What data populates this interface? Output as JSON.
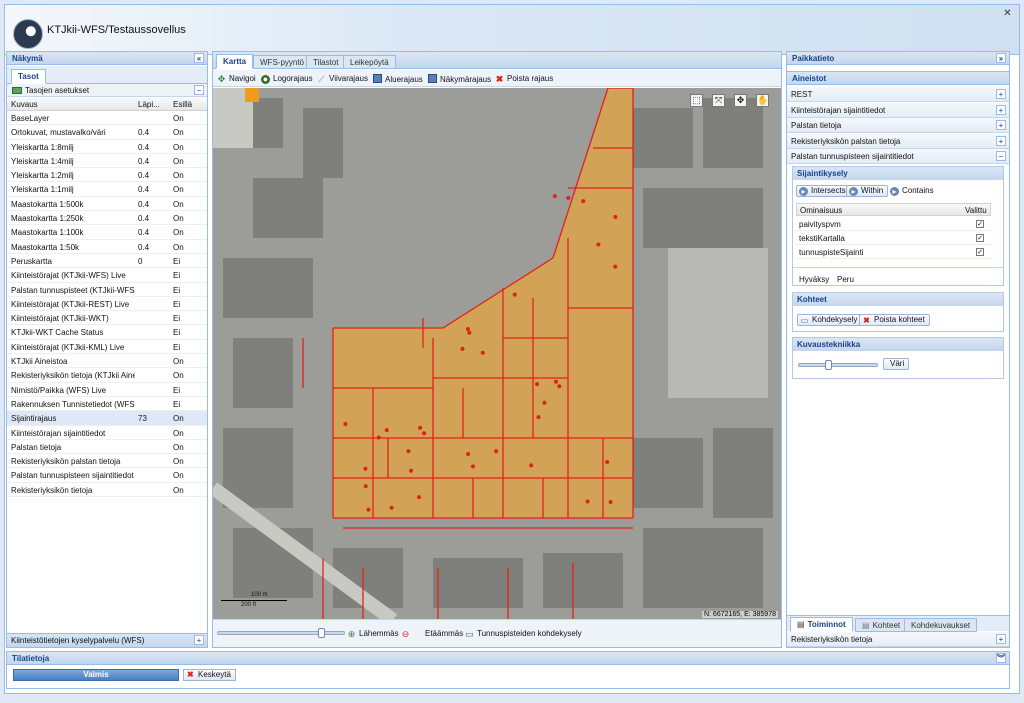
{
  "app": {
    "title": "KTJkii-WFS/Testaussovellus",
    "close_glyph": "✕"
  },
  "left": {
    "title": "Näkymä",
    "collapse_glyph": "«",
    "tab": "Tasot",
    "layer_settings": "Tasojen asetukset",
    "columns": {
      "name": "Kuvaus",
      "opacity": "Läpi...",
      "visible": "Esillä"
    },
    "rows": [
      {
        "name": "BaseLayer",
        "opacity": "",
        "visible": "On"
      },
      {
        "name": "Ortokuvat, mustavalko/väri",
        "opacity": "0.4",
        "visible": "On"
      },
      {
        "name": "Yleiskartta 1:8milj",
        "opacity": "0.4",
        "visible": "On"
      },
      {
        "name": "Yleiskartta 1:4milj",
        "opacity": "0.4",
        "visible": "On"
      },
      {
        "name": "Yleiskartta 1:2milj",
        "opacity": "0.4",
        "visible": "On"
      },
      {
        "name": "Yleiskartta 1:1milj",
        "opacity": "0.4",
        "visible": "On"
      },
      {
        "name": "Maastokartta 1:500k",
        "opacity": "0.4",
        "visible": "On"
      },
      {
        "name": "Maastokartta 1:250k",
        "opacity": "0.4",
        "visible": "On"
      },
      {
        "name": "Maastokartta 1:100k",
        "opacity": "0.4",
        "visible": "On"
      },
      {
        "name": "Maastokartta 1:50k",
        "opacity": "0.4",
        "visible": "On"
      },
      {
        "name": "Peruskartta",
        "opacity": "0",
        "visible": "Ei"
      },
      {
        "name": "Kiinteistörajat (KTJkii-WFS) Live",
        "opacity": "",
        "visible": "Ei"
      },
      {
        "name": "Palstan tunnuspisteet (KTJkii-WFS) ...",
        "opacity": "",
        "visible": "Ei"
      },
      {
        "name": "Kiinteistörajat (KTJkii-REST) Live",
        "opacity": "",
        "visible": "Ei"
      },
      {
        "name": "Kiinteistörajat (KTJkii-WKT)",
        "opacity": "",
        "visible": "Ei"
      },
      {
        "name": "KTJkii-WKT Cache Status",
        "opacity": "",
        "visible": "Ei"
      },
      {
        "name": "Kiinteistörajat (KTJkii-KML) Live",
        "opacity": "",
        "visible": "Ei"
      },
      {
        "name": "KTJkii Aineistoa",
        "opacity": "",
        "visible": "On"
      },
      {
        "name": "Rekisteriyksikön tietoja (KTJkii Ainei...",
        "opacity": "",
        "visible": "On"
      },
      {
        "name": "Nimistö/Paikka (WFS) Live",
        "opacity": "",
        "visible": "Ei"
      },
      {
        "name": "Rakennuksen Tunnistetiedot (WFS) ...",
        "opacity": "",
        "visible": "Ei"
      },
      {
        "name": "Sijaintirajaus",
        "opacity": "73",
        "visible": "On"
      },
      {
        "name": "Kiinteistörajan sijaintitiedot",
        "opacity": "",
        "visible": "On"
      },
      {
        "name": "Palstan tietoja",
        "opacity": "",
        "visible": "On"
      },
      {
        "name": "Rekisteriyksikön palstan tietoja",
        "opacity": "",
        "visible": "On"
      },
      {
        "name": "Palstan tunnuspisteen sijaintitiedot",
        "opacity": "",
        "visible": "On"
      },
      {
        "name": "Rekisteriyksikön tietoja",
        "opacity": "",
        "visible": "On"
      }
    ],
    "footer": "Kiinteistötietojen kyselypalvelu (WFS)"
  },
  "center": {
    "tabs": [
      "Kartta",
      "WFS-pyyntö",
      "Tilastot",
      "Leikepöytä"
    ],
    "tools": [
      "Navigoi",
      "Logorajaus",
      "Viivarajaus",
      "Aluerajaus",
      "Näkymärajaus",
      "Poista rajaus"
    ],
    "coords": "N: 6672165, E: 385978",
    "scale": {
      "m": "100 m",
      "ft": "200 ft"
    },
    "zoom_in": "Lähemmäs",
    "zoom_out": "Etäämmäs",
    "point_query": "Tunnuspisteiden kohdekysely",
    "zoom_level": 0.82
  },
  "right": {
    "title": "Paikkatieto",
    "expand_glyph": "»",
    "datasets_title": "Aineistot",
    "datasets": [
      "REST",
      "Kiinteistörajan sijaintitiedot",
      "Palstan tietoja",
      "Rekisteriyksikön palstan tietoja",
      "Palstan tunnuspisteen sijaintitiedot"
    ],
    "location_query": {
      "title": "Sijaintikysely",
      "ops": [
        "Intersects",
        "Within",
        "Contains"
      ],
      "col_attr": "Ominaisuus",
      "col_sel": "Valittu",
      "attrs": [
        {
          "name": "paivityspvm",
          "checked": "✓"
        },
        {
          "name": "tekstiKartalla",
          "checked": "✓"
        },
        {
          "name": "tunnuspisteSijainti",
          "checked": "✓"
        }
      ],
      "accept": "Hyväksy",
      "cancel": "Peru"
    },
    "targets": {
      "title": "Kohteet",
      "query": "Kohdekysely",
      "remove": "Poista kohteet"
    },
    "style": {
      "title": "Kuvaustekniikka",
      "color": "Väri",
      "level": 0.35
    },
    "bottom_tabs": [
      "Toiminnot",
      "Kohteet",
      "Kohdekuvaukset"
    ],
    "footer": "Rekisteriyksikön tietoja"
  },
  "status": {
    "title": "Tilatietoja",
    "progress": "Valmis",
    "cancel": "Keskeytä"
  },
  "colors": {
    "accent": "#15428b",
    "border": "#99bbe8",
    "parcel_fill": "#e4a542",
    "parcel_line": "#e4201b"
  }
}
